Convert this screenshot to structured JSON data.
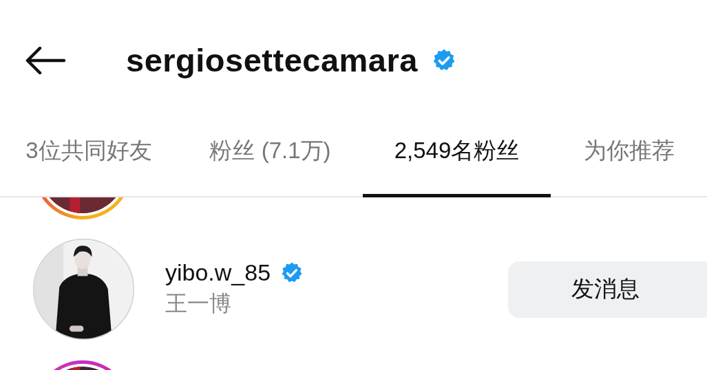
{
  "header": {
    "title": "sergiosettecamara",
    "verified": true
  },
  "tabs": [
    {
      "label": "3位共同好友",
      "selected": false
    },
    {
      "label": "粉丝 (7.1万)",
      "selected": false
    },
    {
      "label": "2,549名粉丝",
      "selected": true
    },
    {
      "label": "为你推荐",
      "selected": false
    }
  ],
  "rows": [
    {
      "kind": "cut_top"
    },
    {
      "kind": "user",
      "username": "yibo.w_85",
      "verified": true,
      "full_name": "王一博",
      "button": "发消息"
    },
    {
      "kind": "cut_bottom"
    }
  ]
}
